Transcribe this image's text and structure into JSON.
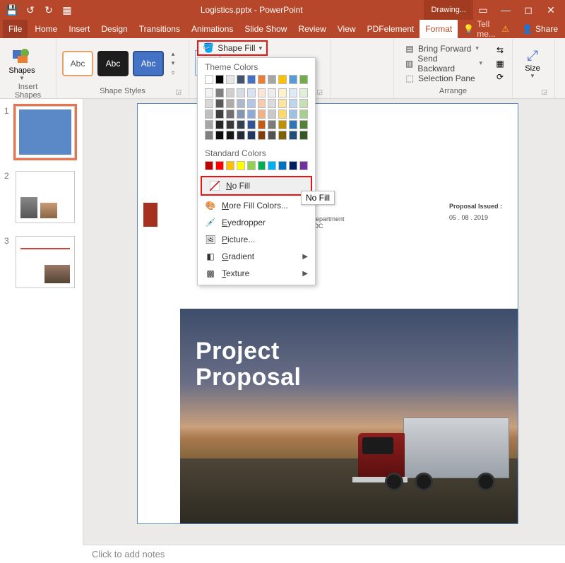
{
  "titlebar": {
    "filename": "Logistics.pptx - PowerPoint",
    "tool_context": "Drawing..."
  },
  "tabs": {
    "file": "File",
    "home": "Home",
    "insert": "Insert",
    "design": "Design",
    "transitions": "Transitions",
    "animations": "Animations",
    "slideshow": "Slide Show",
    "review": "Review",
    "view": "View",
    "pdfelement": "PDFelement",
    "format": "Format",
    "tellme": "Tell me...",
    "share": "Share"
  },
  "ribbon": {
    "insert_shapes": {
      "btn": "Shapes",
      "label": "Insert Shapes"
    },
    "shape_styles": {
      "label": "Shape Styles",
      "abc": "Abc"
    },
    "fill_btn": "Shape Fill",
    "arrange": {
      "bring_forward": "Bring Forward",
      "send_backward": "Send Backward",
      "selection_pane": "Selection Pane",
      "label": "Arrange"
    },
    "size": {
      "btn": "Size"
    }
  },
  "fill_dropdown": {
    "theme_header": "Theme Colors",
    "standard_header": "Standard Colors",
    "no_fill_pre": "N",
    "no_fill_post": "o Fill",
    "more_pre": "M",
    "more_post": "ore Fill Colors...",
    "eyedropper_pre": "E",
    "eyedropper_post": "yedropper",
    "picture_pre": "P",
    "picture_post": "icture...",
    "gradient_pre": "G",
    "gradient_post": "radient",
    "texture_pre": "T",
    "texture_post": "exture",
    "tooltip": "No Fill",
    "theme_rows": [
      [
        "#ffffff",
        "#000000",
        "#e7e6e6",
        "#44546a",
        "#4472c4",
        "#ed7d31",
        "#a5a5a5",
        "#ffc000",
        "#5b9bd5",
        "#70ad47"
      ],
      [
        "#f2f2f2",
        "#7f7f7f",
        "#d0cece",
        "#d6dce4",
        "#d9e2f3",
        "#fbe5d5",
        "#ededed",
        "#fff2cc",
        "#deebf6",
        "#e2efd9"
      ],
      [
        "#d8d8d8",
        "#595959",
        "#aeabab",
        "#adb9ca",
        "#b4c6e7",
        "#f7cbac",
        "#dbdbdb",
        "#fee599",
        "#bdd7ee",
        "#c5e0b3"
      ],
      [
        "#bfbfbf",
        "#3f3f3f",
        "#757070",
        "#8496b0",
        "#8eaadb",
        "#f4b183",
        "#c9c9c9",
        "#ffd965",
        "#9cc3e5",
        "#a8d08d"
      ],
      [
        "#a5a5a5",
        "#262626",
        "#3a3838",
        "#323f4f",
        "#2f5496",
        "#c55a11",
        "#7b7b7b",
        "#bf9000",
        "#2e75b5",
        "#538135"
      ],
      [
        "#7f7f7f",
        "#0c0c0c",
        "#171616",
        "#222a35",
        "#1f3864",
        "#833c0b",
        "#525252",
        "#7f6000",
        "#1e4e79",
        "#375623"
      ]
    ],
    "standard_row": [
      "#c00000",
      "#ff0000",
      "#ffc000",
      "#ffff00",
      "#92d050",
      "#00b050",
      "#00b0f0",
      "#0070c0",
      "#002060",
      "#7030a0"
    ]
  },
  "thumbs": {
    "n1": "1",
    "n2": "2",
    "n3": "3"
  },
  "slide": {
    "proposal_label": "Proposal Issued :",
    "proposal_date": "05 . 08 . 2019",
    "dept_line1": "Parks Department",
    "dept_line2": "ington, DC",
    "hero_title_1": "Project",
    "hero_title_2": "Proposal"
  },
  "notes_placeholder": "Click to add notes"
}
